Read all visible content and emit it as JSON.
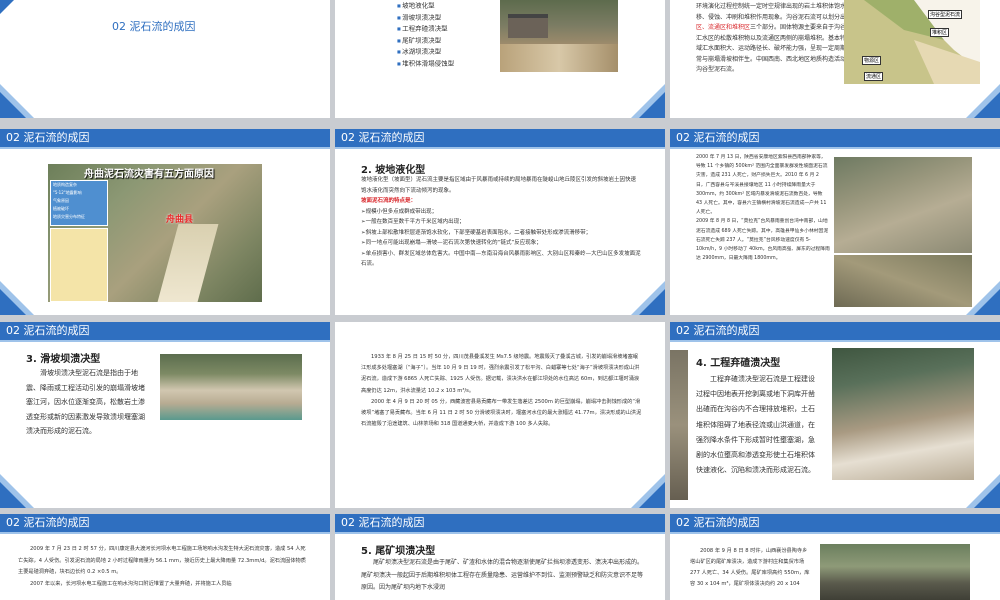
{
  "header_label": "02  泥石流的成因",
  "s1": {
    "title": "02  泥石流的成因"
  },
  "s2": {
    "items": [
      "坡地液化型",
      "滑坡坝溃决型",
      "工程弃碴溃决型",
      "尾矿坝溃决型",
      "冰湖坝溃决型",
      "堆积体滑塌侵蚀型"
    ]
  },
  "s3": {
    "text": "环境演化过程控制统一定时空规律出现的岩土堆积体饱水、运移、侵蚀、冲刷和堆积作用现象。沟谷泥石流可以划分出",
    "red": "物源区、流通区和堆积区",
    "text2": "三个部分。固体物源主要来自于沟谷源头汇水区的松散堆积物以及流通区两侧的崩塌堆积。基本特征是流域汇水面积大、运动路径长、破坏能力强，呈现一定周期性，且常与崩塌滑坡相伴生。中国西南、西北地区地质构造活动区多发沟谷型泥石流。",
    "diagram_labels": [
      "物源区",
      "堆积区",
      "流通区",
      "沟谷型泥石流"
    ]
  },
  "s4": {
    "map_title": "舟曲泥石流灾害有五方面原因",
    "legend": [
      "地质构造复杂",
      "\"5·12\"地震影响",
      "气象原因",
      "植被破坏",
      "地质灾害分布特征"
    ],
    "county": "舟曲县"
  },
  "s5": {
    "heading": "2. 坡地液化型",
    "intro": "坡地液化型（坡面型）泥石流主要是指区域由于风暴雨或持续的局地暴雨在陡峻山地丘陵区引发的斜坡岩土因快速饱水液化而突然向下流动倾泻的现象。",
    "feature_title": "坡面泥石流的特点是：",
    "points": [
      "➢规模小但多点成群成带出现；",
      "➢一般在数百至数千平方千米区域内出现；",
      "➢斜坡上部松散堆积层逐渐饱水软化，下部坚硬基岩表面阻水，二者接触带处形成渗流滑移带；",
      "➢同一地点可能出现崩塌—滑坡—泥石流次第快速转化的“链式”反应现象；",
      "➢单点损害小、群发区域总体危害大。中国中南—东南沿海台风暴雨影响区、大别山区和秦岭—大巴山区多发坡面泥石流。"
    ]
  },
  "s6": {
    "text": "2000 年 7 月 13 日，陕西省安康地区紫阳县西南部钟家等，导致 11 个乡镇的 500km² 范围内全面暴发群发性坡面泥石流灾害，造成 231 人死亡，财产损失巨大。2010 年 6 月 2 日，广西容县与岑溪县接壤地区 11 小时持续降雨量大于 300mm，约 300km² 区域内暴发滑坡泥石流数百处，导致 43 人死亡。其中，容县六王镇横村滑坡泥石流造成一户共 11 人死亡。",
    "text2": "2009 年 8 月 8 日，“莫拉克”台风暴雨重创台湾中南部，山地泥石流造成 689 人死亡失踪。其中，高雄县甲仙乡小林村因泥石流死亡失踪 237 人。“莫拉克”台风移动速度仅有 5-10km/h，9 小时移动了 40km，台风雨高强、屏东的过程降雨达 2900mm，日最大降雨 1800mm。"
  },
  "s7": {
    "heading": "3. 滑坡坝溃决型",
    "text": "滑坡坝溃决型泥石流是指由于地震、降雨或工程活动引发的崩塌滑坡堵塞江河，因水位逐渐变高，松散岩土渗透变形或新的因素激发导致溃坝堰塞湖溃决而形成的泥石流。"
  },
  "s8": {
    "text": "1933 年 8 月 25 日 15 时 50 分，四川茂县叠溪发生 Ms7.5 级地震。地震毁灭了叠溪古城，引发的崩塌滑坡堵塞岷江形成多处堰塞湖（“海子”）。当年 10 月 9 日 19 时，强烈余震引发了松平沟、白蜡寨等七处“海子”滑坡坝溃决形成山洪泥石流，造成下游 6865 人死亡失踪、1925 人受伤。据记载，溃决洪水在都江坝处的水位高达 60m，到达都江堰时涌浪高度仍达 12m，洪水流量达 10.2 x 103 m³/s。",
    "text2": "2000 年 4 月 9 日 20 时 05 分，西藏波密县易贡藏布一带发生落差达 2500m 的巨型崩塌，崩塌冲击剥蚀形成的“滑坡坝”堵塞了易贡藏布。当年 6 月 11 日 2 时 50 分滑坡坝溃决时，堰塞河水位的最大涨幅达 41.77m，溃决形成的山洪泥石流摧毁了沿途建筑、山林茶场和 318 国道通麦大桥，并造成下游 100 多人失踪。"
  },
  "s9": {
    "heading": "4. 工程弃碴溃决型",
    "text": "工程弃碴溃决型泥石流是工程建设过程中因地表开挖剥离或地下洞库开凿出碴而在沟谷内不合理排放堆积，土石堆积体阻碍了地表径流或山洪通道，在强烈降水条件下形成暂时性壅塞湖，急剧的水位壅高和渗透变形使土石堆积体快速液化、沉陷和溃决而形成泥石流。"
  },
  "s10": {
    "text": "2009 年 7 月 23 日 2 时 57 分，四川康定县大渡河长河坝水电工程施工场地响水沟发生特大泥石流灾害，造成 54 人死亡失踪，4 人受伤。引发泥石流的局地 2 小时过程降雨量为 56.1 mm，接近历史上最大降雨量 72.3mm/d。泥石流固体物质主要是碴洞弃碴，块石边长约 0.2 ×0.5 m。",
    "text2": "2007 年以来，长河坝水电工程施工在响水沟沟口附近堆置了大量弃碴，并将施工人员临"
  },
  "s11": {
    "heading": "5. 尾矿坝溃决型",
    "text": "尾矿坝溃决型泥石流是由于尾矿、矿渣和水体的混合物逐渐使尾矿拦挡坝渗透变形、溃决冲出形成的。尾矿坝溃决一般起因于后期堆积坝体工程存在质量隐患、运营维护不到位、监测预警缺乏和防灾意识不足等原因。因为尾矿坝内地下水浸润"
  },
  "s12": {
    "text": "2008 年 9 月 8 日 8 时许，山西襄汾县陶寺乡塔山矿区的尾矿库溃决，造成下游村庄和集贸市场 277 人死亡、34 人受伤。尾矿库坝高约 550m，库容 30 x 104 m³，尾矿坝体溃决向约 20 x 104"
  }
}
